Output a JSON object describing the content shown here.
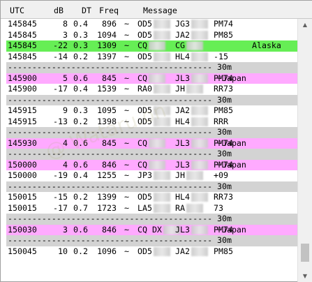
{
  "header": {
    "utc": "UTC",
    "db": "dB",
    "dt": "DT",
    "freq": "Freq",
    "message": "Message"
  },
  "colors": {
    "highlight_green": "#66ee55",
    "highlight_pink": "#ffaaff",
    "separator_gray": "#d3d3d3"
  },
  "watermark": "@ Wataru.on",
  "rows": [
    {
      "type": "msg",
      "utc": "145845",
      "db": "8",
      "dt": "0.4",
      "freq": "896",
      "tilde": "~",
      "msg_parts": [
        "OD5",
        "JG3",
        "PM74"
      ],
      "note": "",
      "hl": ""
    },
    {
      "type": "msg",
      "utc": "145845",
      "db": "3",
      "dt": "0.3",
      "freq": "1094",
      "tilde": "~",
      "msg_parts": [
        "OD5",
        "JA2",
        "PM85"
      ],
      "note": "",
      "hl": ""
    },
    {
      "type": "msg",
      "utc": "145845",
      "db": "-22",
      "dt": "0.3",
      "freq": "1309",
      "tilde": "~",
      "msg_parts": [
        "CQ",
        "CG",
        ""
      ],
      "note": "Alaska",
      "hl": "green"
    },
    {
      "type": "msg",
      "utc": "145845",
      "db": "-14",
      "dt": "0.2",
      "freq": "1397",
      "tilde": "~",
      "msg_parts": [
        "OD5",
        "HL4",
        "-15"
      ],
      "note": "",
      "hl": ""
    },
    {
      "type": "sep",
      "dashes": "------------------------------------------",
      "band": "30m"
    },
    {
      "type": "msg",
      "utc": "145900",
      "db": "5",
      "dt": "0.6",
      "freq": "845",
      "tilde": "~",
      "msg_parts": [
        "CQ",
        "JL3",
        "PM74"
      ],
      "note": "~Japan",
      "hl": "pink"
    },
    {
      "type": "msg",
      "utc": "145900",
      "db": "-17",
      "dt": "0.4",
      "freq": "1539",
      "tilde": "~",
      "msg_parts": [
        "RA0",
        "JH",
        "RR73"
      ],
      "note": "",
      "hl": ""
    },
    {
      "type": "sep",
      "dashes": "------------------------------------------",
      "band": "30m"
    },
    {
      "type": "msg",
      "utc": "145915",
      "db": "9",
      "dt": "0.3",
      "freq": "1095",
      "tilde": "~",
      "msg_parts": [
        "OD5",
        "JA2",
        "PM85"
      ],
      "note": "",
      "hl": ""
    },
    {
      "type": "msg",
      "utc": "145915",
      "db": "-13",
      "dt": "0.2",
      "freq": "1398",
      "tilde": "~",
      "msg_parts": [
        "OD5",
        "HL4",
        "RRR"
      ],
      "note": "",
      "hl": ""
    },
    {
      "type": "sep",
      "dashes": "------------------------------------------",
      "band": "30m"
    },
    {
      "type": "msg",
      "utc": "145930",
      "db": "4",
      "dt": "0.6",
      "freq": "845",
      "tilde": "~",
      "msg_parts": [
        "CQ",
        "JL3",
        "PM74"
      ],
      "note": "~Japan",
      "hl": "pink"
    },
    {
      "type": "sep",
      "dashes": "------------------------------------------",
      "band": "30m"
    },
    {
      "type": "msg",
      "utc": "150000",
      "db": "4",
      "dt": "0.6",
      "freq": "846",
      "tilde": "~",
      "msg_parts": [
        "CQ",
        "JL3",
        "PM74"
      ],
      "note": "~Japan",
      "hl": "pink"
    },
    {
      "type": "msg",
      "utc": "150000",
      "db": "-19",
      "dt": "0.4",
      "freq": "1255",
      "tilde": "~",
      "msg_parts": [
        "JP3",
        "JH",
        "+09"
      ],
      "note": "",
      "hl": ""
    },
    {
      "type": "sep",
      "dashes": "------------------------------------------",
      "band": "30m"
    },
    {
      "type": "msg",
      "utc": "150015",
      "db": "-15",
      "dt": "0.2",
      "freq": "1399",
      "tilde": "~",
      "msg_parts": [
        "OD5",
        "HL4",
        "RR73"
      ],
      "note": "",
      "hl": ""
    },
    {
      "type": "msg",
      "utc": "150015",
      "db": "-17",
      "dt": "0.7",
      "freq": "1723",
      "tilde": "~",
      "msg_parts": [
        "LA5",
        "RA",
        "73"
      ],
      "note": "",
      "hl": ""
    },
    {
      "type": "sep",
      "dashes": "------------------------------------------",
      "band": "30m"
    },
    {
      "type": "msg",
      "utc": "150030",
      "db": "3",
      "dt": "0.6",
      "freq": "846",
      "tilde": "~",
      "msg_parts": [
        "CQ DX",
        "JL3",
        "PM74"
      ],
      "note": "~Japan",
      "hl": "pink"
    },
    {
      "type": "sep",
      "dashes": "------------------------------------------",
      "band": "30m"
    },
    {
      "type": "msg",
      "utc": "150045",
      "db": "10",
      "dt": "0.2",
      "freq": "1096",
      "tilde": "~",
      "msg_parts": [
        "OD5",
        "JA2",
        "PM85"
      ],
      "note": "",
      "hl": ""
    }
  ]
}
